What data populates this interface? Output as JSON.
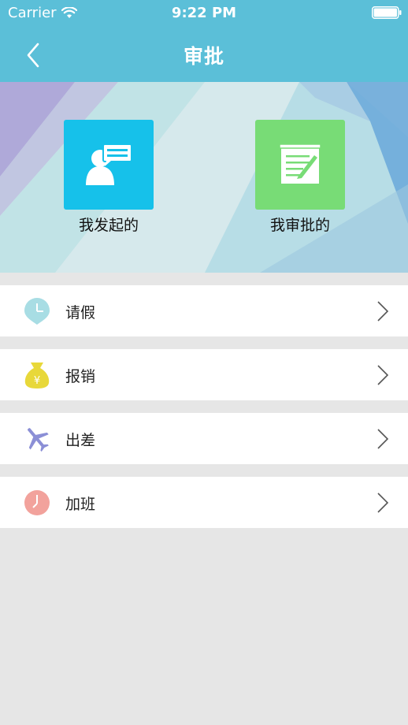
{
  "status_bar": {
    "carrier": "Carrier",
    "time": "9:22 PM"
  },
  "nav": {
    "title": "审批"
  },
  "banner": {
    "tiles": [
      {
        "label": "我发起的",
        "icon": "chat-person-icon",
        "color": "#16c1ea"
      },
      {
        "label": "我审批的",
        "icon": "notepad-pencil-icon",
        "color": "#78dc76"
      }
    ]
  },
  "list": {
    "items": [
      {
        "label": "请假",
        "icon": "clock-pin-icon",
        "color": "#a8dde4"
      },
      {
        "label": "报销",
        "icon": "money-bag-icon",
        "color": "#e8d83a"
      },
      {
        "label": "出差",
        "icon": "airplane-icon",
        "color": "#8b8fd6"
      },
      {
        "label": "加班",
        "icon": "clock-icon",
        "color": "#f2a29c"
      }
    ]
  },
  "colors": {
    "header": "#5bbfd8",
    "background": "#e6e6e6"
  }
}
